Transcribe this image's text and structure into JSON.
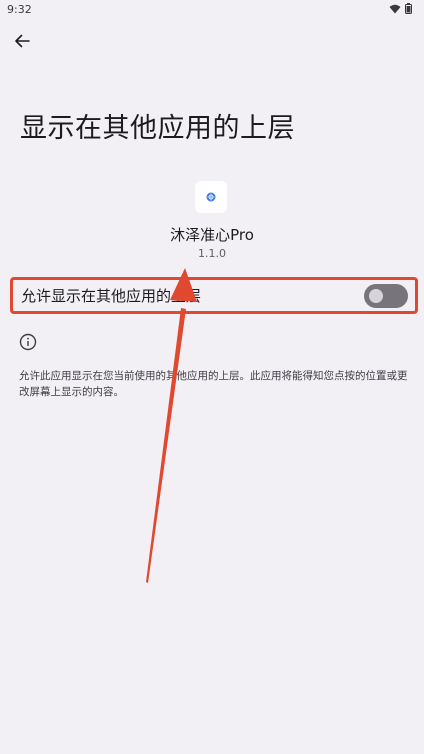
{
  "status_bar": {
    "time": "9:32"
  },
  "page": {
    "title": "显示在其他应用的上层"
  },
  "app": {
    "name": "沐泽准心Pro",
    "version": "1.1.0"
  },
  "permission": {
    "label": "允许显示在其他应用的上层",
    "enabled": false
  },
  "description": "允许此应用显示在您当前使用的其他应用的上层。此应用将能得知您点按的位置或更改屏幕上显示的内容。",
  "colors": {
    "background": "#f2f0f4",
    "highlight": "#e0482f",
    "toggle_off": "#77757b",
    "app_icon_accent": "#3f7be0"
  }
}
